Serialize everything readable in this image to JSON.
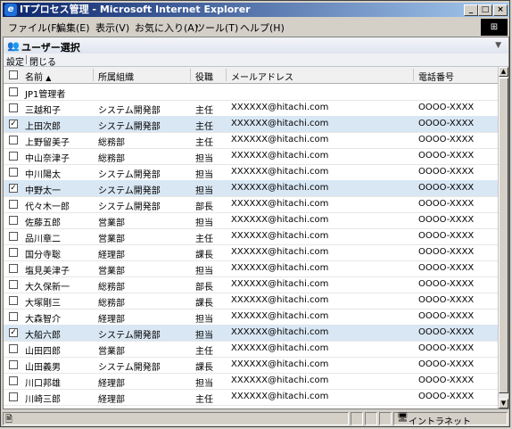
{
  "window": {
    "title": "ITプロセス管理 - Microsoft Internet Explorer"
  },
  "menu": [
    "ファイル(F)",
    "編集(E)",
    "表示(V)",
    "お気に入り(A)",
    "ツール(T)",
    "ヘルプ(H)"
  ],
  "panel": {
    "title": "ユーザー選択"
  },
  "toolbar": {
    "settings_label": "設定",
    "close_label": "閉じる"
  },
  "columns": {
    "name": "名前",
    "sort_indicator": "▲",
    "dept": "所属組織",
    "position": "役職",
    "email": "メールアドレス",
    "phone": "電話番号"
  },
  "rows": [
    {
      "name": "JP1管理者",
      "dept": "",
      "position": "",
      "email": "",
      "phone": "",
      "checked": false
    },
    {
      "name": "三越和子",
      "dept": "システム開発部",
      "position": "主任",
      "email": "XXXXXX@hitachi.com",
      "phone": "OOOO-XXXX",
      "checked": false
    },
    {
      "name": "上田次郎",
      "dept": "システム開発部",
      "position": "主任",
      "email": "XXXXXX@hitachi.com",
      "phone": "OOOO-XXXX",
      "checked": true
    },
    {
      "name": "上野留美子",
      "dept": "総務部",
      "position": "主任",
      "email": "XXXXXX@hitachi.com",
      "phone": "OOOO-XXXX",
      "checked": false
    },
    {
      "name": "中山奈津子",
      "dept": "総務部",
      "position": "担当",
      "email": "XXXXXX@hitachi.com",
      "phone": "OOOO-XXXX",
      "checked": false
    },
    {
      "name": "中川陽太",
      "dept": "システム開発部",
      "position": "担当",
      "email": "XXXXXX@hitachi.com",
      "phone": "OOOO-XXXX",
      "checked": false
    },
    {
      "name": "中野太一",
      "dept": "システム開発部",
      "position": "担当",
      "email": "XXXXXX@hitachi.com",
      "phone": "OOOO-XXXX",
      "checked": true
    },
    {
      "name": "代々木一郎",
      "dept": "システム開発部",
      "position": "部長",
      "email": "XXXXXX@hitachi.com",
      "phone": "OOOO-XXXX",
      "checked": false
    },
    {
      "name": "佐藤五郎",
      "dept": "営業部",
      "position": "担当",
      "email": "XXXXXX@hitachi.com",
      "phone": "OOOO-XXXX",
      "checked": false
    },
    {
      "name": "品川章二",
      "dept": "営業部",
      "position": "主任",
      "email": "XXXXXX@hitachi.com",
      "phone": "OOOO-XXXX",
      "checked": false
    },
    {
      "name": "国分寺聡",
      "dept": "経理部",
      "position": "課長",
      "email": "XXXXXX@hitachi.com",
      "phone": "OOOO-XXXX",
      "checked": false
    },
    {
      "name": "塩見美津子",
      "dept": "営業部",
      "position": "担当",
      "email": "XXXXXX@hitachi.com",
      "phone": "OOOO-XXXX",
      "checked": false
    },
    {
      "name": "大久保新一",
      "dept": "総務部",
      "position": "部長",
      "email": "XXXXXX@hitachi.com",
      "phone": "OOOO-XXXX",
      "checked": false
    },
    {
      "name": "大塚剛三",
      "dept": "総務部",
      "position": "課長",
      "email": "XXXXXX@hitachi.com",
      "phone": "OOOO-XXXX",
      "checked": false
    },
    {
      "name": "大森智介",
      "dept": "経理部",
      "position": "担当",
      "email": "XXXXXX@hitachi.com",
      "phone": "OOOO-XXXX",
      "checked": false
    },
    {
      "name": "大船六郎",
      "dept": "システム開発部",
      "position": "担当",
      "email": "XXXXXX@hitachi.com",
      "phone": "OOOO-XXXX",
      "checked": true
    },
    {
      "name": "山田四郎",
      "dept": "営業部",
      "position": "主任",
      "email": "XXXXXX@hitachi.com",
      "phone": "OOOO-XXXX",
      "checked": false
    },
    {
      "name": "山田義男",
      "dept": "システム開発部",
      "position": "課長",
      "email": "XXXXXX@hitachi.com",
      "phone": "OOOO-XXXX",
      "checked": false
    },
    {
      "name": "川口邦雄",
      "dept": "経理部",
      "position": "担当",
      "email": "XXXXXX@hitachi.com",
      "phone": "OOOO-XXXX",
      "checked": false
    },
    {
      "name": "川崎三郎",
      "dept": "経理部",
      "position": "主任",
      "email": "XXXXXX@hitachi.com",
      "phone": "OOOO-XXXX",
      "checked": false
    }
  ],
  "statusbar": {
    "zone": "イントラネット"
  }
}
